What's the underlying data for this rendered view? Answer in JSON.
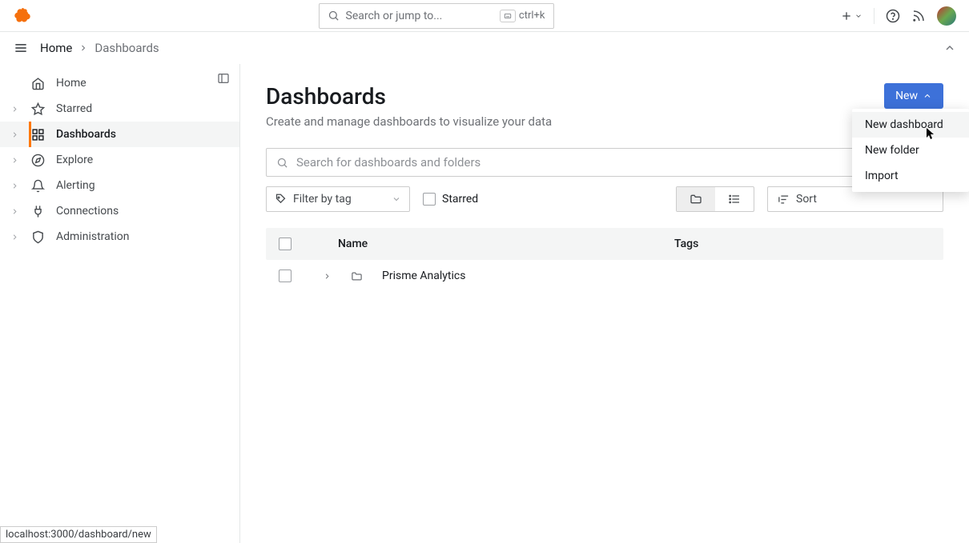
{
  "topbar": {
    "search_placeholder": "Search or jump to...",
    "shortcut": "ctrl+k"
  },
  "breadcrumb": {
    "home": "Home",
    "current": "Dashboards"
  },
  "sidebar": {
    "items": [
      {
        "label": "Home",
        "icon": "home",
        "expandable": false
      },
      {
        "label": "Starred",
        "icon": "star",
        "expandable": true
      },
      {
        "label": "Dashboards",
        "icon": "grid",
        "expandable": true,
        "active": true
      },
      {
        "label": "Explore",
        "icon": "compass",
        "expandable": true
      },
      {
        "label": "Alerting",
        "icon": "bell",
        "expandable": true
      },
      {
        "label": "Connections",
        "icon": "plug",
        "expandable": true
      },
      {
        "label": "Administration",
        "icon": "shield",
        "expandable": true
      }
    ]
  },
  "page": {
    "title": "Dashboards",
    "subtitle": "Create and manage dashboards to visualize your data",
    "new_button": "New"
  },
  "new_menu": {
    "items": [
      "New dashboard",
      "New folder",
      "Import"
    ]
  },
  "filters": {
    "search_placeholder": "Search for dashboards and folders",
    "tag_label": "Filter by tag",
    "starred_label": "Starred",
    "sort_label": "Sort"
  },
  "table": {
    "col_name": "Name",
    "col_tags": "Tags",
    "rows": [
      {
        "name": "Prisme Analytics"
      }
    ]
  },
  "status_bar": "localhost:3000/dashboard/new"
}
